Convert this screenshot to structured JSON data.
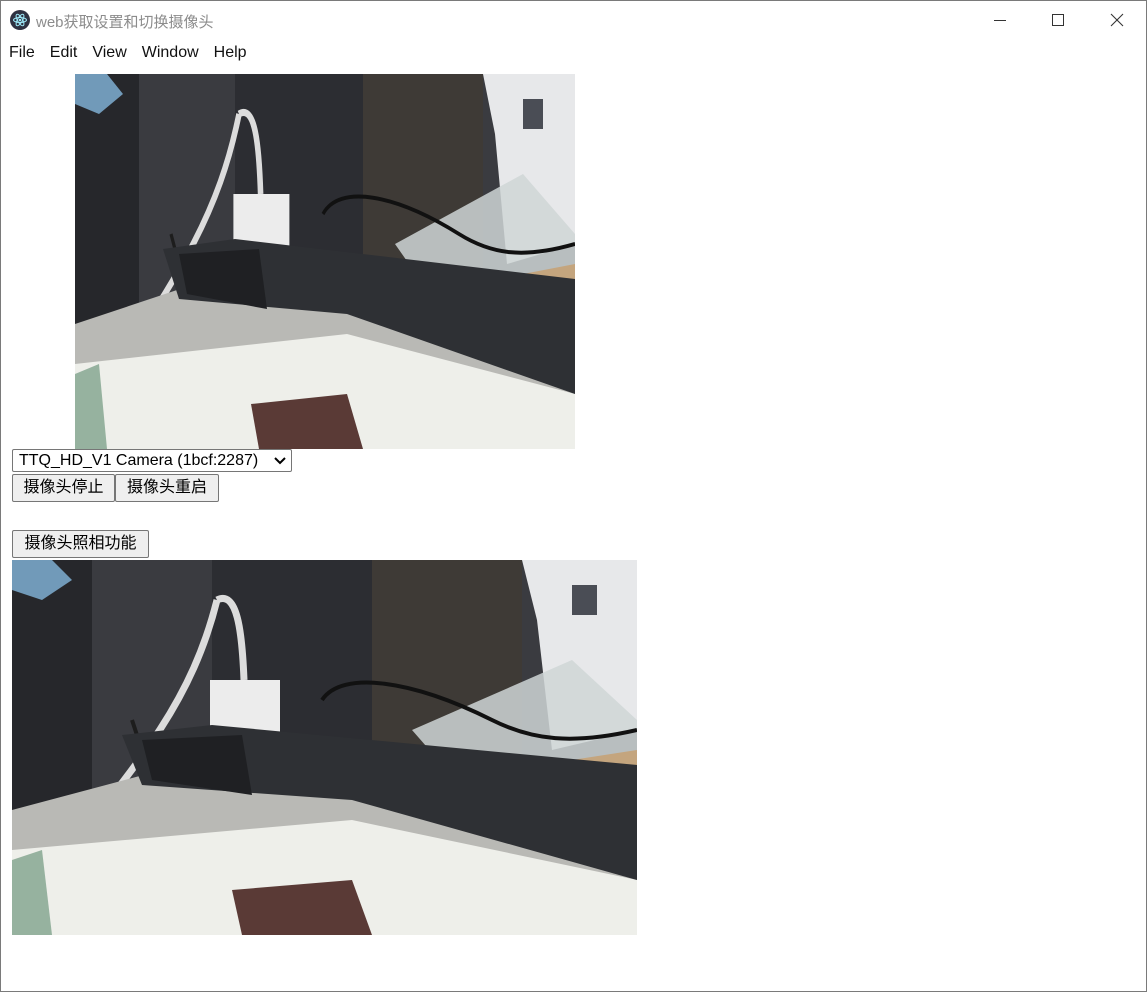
{
  "window": {
    "title": "web获取设置和切换摄像头",
    "controls": [
      "minimize",
      "maximize",
      "close"
    ]
  },
  "menu": [
    "File",
    "Edit",
    "View",
    "Window",
    "Help"
  ],
  "camera_select": {
    "selected": "TTQ_HD_V1 Camera (1bcf:2287)"
  },
  "buttons": {
    "stop": "摄像头停止",
    "restart": "摄像头重启",
    "photo": "摄像头照相功能"
  },
  "icons": {
    "app": "electron-atom-icon",
    "minimize": "minimize-icon",
    "maximize": "maximize-icon",
    "close": "close-icon",
    "dropdown": "chevron-down-icon"
  }
}
